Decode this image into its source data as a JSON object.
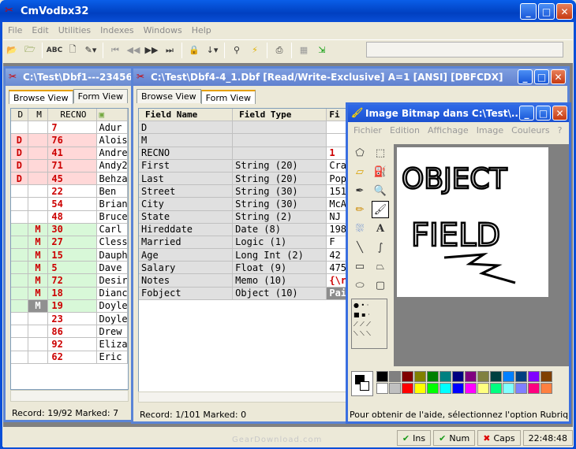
{
  "app": {
    "title": "CmVodbx32"
  },
  "menu": [
    "File",
    "Edit",
    "Utilities",
    "Indexes",
    "Windows",
    "Help"
  ],
  "toolbar": {
    "abc_label": "ABC"
  },
  "win1": {
    "title": "C:\\Test\\Dbf1---23456",
    "tabs": [
      "Browse View",
      "Form View"
    ],
    "headers": [
      "D",
      "M",
      "RECNO",
      ""
    ],
    "rows": [
      {
        "d": "",
        "m": "",
        "recno": "7",
        "name": "Adur",
        "color": "white"
      },
      {
        "d": "D",
        "m": "",
        "recno": "76",
        "name": "Alois",
        "color": "pink"
      },
      {
        "d": "D",
        "m": "",
        "recno": "41",
        "name": "Andre",
        "color": "pink"
      },
      {
        "d": "D",
        "m": "",
        "recno": "71",
        "name": "Andy2",
        "color": "pink"
      },
      {
        "d": "D",
        "m": "",
        "recno": "45",
        "name": "Behza",
        "color": "pink"
      },
      {
        "d": "",
        "m": "",
        "recno": "22",
        "name": "Ben",
        "color": "white"
      },
      {
        "d": "",
        "m": "",
        "recno": "54",
        "name": "Brian",
        "color": "white"
      },
      {
        "d": "",
        "m": "",
        "recno": "48",
        "name": "Bruce",
        "color": "white"
      },
      {
        "d": "",
        "m": "M",
        "recno": "30",
        "name": "Carl",
        "color": "green"
      },
      {
        "d": "",
        "m": "M",
        "recno": "27",
        "name": "Cless",
        "color": "green"
      },
      {
        "d": "",
        "m": "M",
        "recno": "15",
        "name": "Dauph",
        "color": "green"
      },
      {
        "d": "",
        "m": "M",
        "recno": "5",
        "name": "Dave",
        "color": "green"
      },
      {
        "d": "",
        "m": "M",
        "recno": "72",
        "name": "Desir",
        "color": "green"
      },
      {
        "d": "",
        "m": "M",
        "recno": "18",
        "name": "Dianc",
        "color": "green"
      },
      {
        "d": "",
        "m": "M",
        "recno": "19",
        "name": "Doyle",
        "color": "green",
        "selected": true
      },
      {
        "d": "",
        "m": "",
        "recno": "23",
        "name": "Doyle",
        "color": "white"
      },
      {
        "d": "",
        "m": "",
        "recno": "86",
        "name": "Drew",
        "color": "white"
      },
      {
        "d": "",
        "m": "",
        "recno": "92",
        "name": "Eliza",
        "color": "white"
      },
      {
        "d": "",
        "m": "",
        "recno": "62",
        "name": "Eric",
        "color": "white"
      }
    ],
    "status": "Record: 19/92 Marked: 7"
  },
  "win2": {
    "title": "C:\\Test\\Dbf4-4_1.Dbf [Read/Write-Exclusive]  A=1 [ANSI] [DBFCDX]",
    "tabs": [
      "Browse View",
      "Form View"
    ],
    "headers": [
      "Field Name",
      "Field Type",
      "Fi"
    ],
    "rows": [
      {
        "name": "D",
        "type": "",
        "val": ""
      },
      {
        "name": "M",
        "type": "",
        "val": ""
      },
      {
        "name": "RECNO",
        "type": "",
        "val": "1",
        "red": true
      },
      {
        "name": "First",
        "type": "String (20)",
        "val": "Cra"
      },
      {
        "name": "Last",
        "type": "String (20)",
        "val": "Pop"
      },
      {
        "name": "Street",
        "type": "String (30)",
        "val": "151"
      },
      {
        "name": "City",
        "type": "String (30)",
        "val": "McA"
      },
      {
        "name": "State",
        "type": "String (2)",
        "val": "NJ"
      },
      {
        "name": "Hireddate",
        "type": "Date (8)",
        "val": "198"
      },
      {
        "name": "Married",
        "type": "Logic (1)",
        "val": "F"
      },
      {
        "name": "Age",
        "type": "Long Int (2)",
        "val": "42"
      },
      {
        "name": "Salary",
        "type": "Float (9)",
        "val": "475"
      },
      {
        "name": "Notes",
        "type": "Memo (10)",
        "val": "{\\r",
        "red": true
      },
      {
        "name": "Fobject",
        "type": "Object (10)",
        "val": "Pai",
        "dark": true
      }
    ],
    "status": "Record: 1/101 Marked: 0"
  },
  "paint": {
    "title": "Image Bitmap dans C:\\Test\\...",
    "menu": [
      "Fichier",
      "Edition",
      "Affichage",
      "Image",
      "Couleurs",
      "?"
    ],
    "canvas_text": [
      "OBJECT",
      "FIELD"
    ],
    "status": "Pour obtenir de l'aide, sélectionnez l'option Rubriques d'",
    "palette_top": [
      "#000000",
      "#808080",
      "#800000",
      "#808000",
      "#008000",
      "#008080",
      "#000080",
      "#800080",
      "#808040",
      "#004040",
      "#0080ff",
      "#004080",
      "#8000ff",
      "#804000"
    ],
    "palette_bottom": [
      "#ffffff",
      "#c0c0c0",
      "#ff0000",
      "#ffff00",
      "#00ff00",
      "#00ffff",
      "#0000ff",
      "#ff00ff",
      "#ffff80",
      "#00ff80",
      "#80ffff",
      "#8080ff",
      "#ff0080",
      "#ff8040"
    ]
  },
  "statusbar": {
    "ins": "Ins",
    "num": "Num",
    "caps": "Caps",
    "time": "22:48:48"
  },
  "watermark": "GearDownload.com"
}
